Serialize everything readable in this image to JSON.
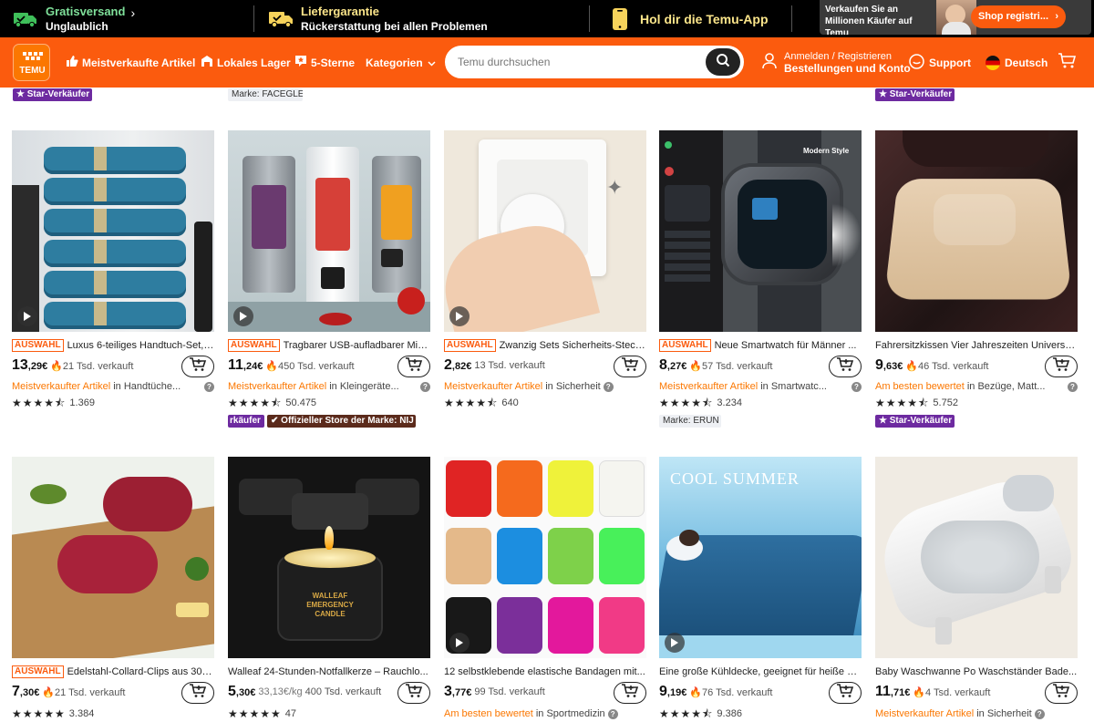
{
  "promo": {
    "shipping_title": "Gratisversand",
    "shipping_sub": "Unglaublich",
    "guarantee_title": "Liefergarantie",
    "guarantee_sub": "Rückerstattung bei allen Problemen",
    "app": "Hol dir die Temu-App",
    "sell_text": "Verkaufen Sie an Millionen Käufer auf Temu",
    "shop_btn": "Shop registri..."
  },
  "nav": {
    "logo": "TEMU",
    "best": "Meistverkaufte Artikel",
    "local": "Lokales Lager",
    "stars": "5-Sterne",
    "cat": "Kategorien",
    "search_placeholder": "Temu durchsuchen",
    "login": "Anmelden / Registrieren",
    "orders": "Bestellungen und Konto",
    "support": "Support",
    "lang": "Deutsch"
  },
  "badges": {
    "star": "Star-Verkäufer",
    "brand_top": "Marke: FACEGLE",
    "star_right": "Star-Verkäufer",
    "row2_left": "rkäufer",
    "official": "Offizieller Store der Marke: NIJ",
    "brand_erun": "Marke: ERUN",
    "star_row2": "Star-Verkäufer"
  },
  "products": [
    {
      "tag": "AUSWAHL",
      "title": "Luxus 6-teiliges Handtuch-Set, ...",
      "price_int": "13",
      "price_dec": ",29€",
      "sold": "21 Tsd. verkauft",
      "hl": "Meistverkaufter Artikel",
      "cat": "in Handtüche...",
      "stars": "★★★★⯪",
      "rating": "1.369"
    },
    {
      "tag": "AUSWAHL",
      "title": "Tragbarer USB-aufladbarer Mix...",
      "price_int": "11",
      "price_dec": ",24€",
      "sold": "450 Tsd. verkauft",
      "hl": "Meistverkaufter Artikel",
      "cat": "in Kleingeräte...",
      "stars": "★★★★⯪",
      "rating": "50.475"
    },
    {
      "tag": "AUSWAHL",
      "title": "Zwanzig Sets Sicherheits-Steck...",
      "price_int": "2",
      "price_dec": ",82€",
      "sold": "13 Tsd. verkauft",
      "hl": "Meistverkaufter Artikel",
      "cat": "in Sicherheit",
      "stars": "★★★★⯪",
      "rating": "640"
    },
    {
      "tag": "AUSWAHL",
      "title": "Neue Smartwatch für Männer ...",
      "price_int": "8",
      "price_dec": ",27€",
      "sold": "57 Tsd. verkauft",
      "hl": "Meistverkaufter Artikel",
      "cat": "in Smartwatc...",
      "stars": "★★★★⯪",
      "rating": "3.234"
    },
    {
      "tag": "",
      "title": "Fahrersitzkissen Vier Jahreszeiten Universal...",
      "price_int": "9",
      "price_dec": ",63€",
      "sold": "46 Tsd. verkauft",
      "hl": "Am besten bewertet",
      "cat": "in Bezüge, Matt...",
      "stars": "★★★★⯪",
      "rating": "5.752"
    },
    {
      "tag": "AUSWAHL",
      "title": "Edelstahl-Collard-Clips aus 304...",
      "price_int": "7",
      "price_dec": ",30€",
      "sold": "21 Tsd. verkauft",
      "hl": "",
      "cat": "",
      "stars": "★★★★★",
      "rating": "3.384"
    },
    {
      "tag": "",
      "title": "Walleaf 24-Stunden-Notfallkerze – Rauchlo...",
      "price_int": "5",
      "price_dec": ",30€",
      "sold": "400 Tsd. verkauft",
      "unit": "33,13€/kg",
      "hl": "",
      "cat": "",
      "stars": "★★★★★",
      "rating": "47"
    },
    {
      "tag": "",
      "title": "12 selbstklebende elastische Bandagen mit...",
      "price_int": "3",
      "price_dec": ",77€",
      "sold": "99 Tsd. verkauft",
      "hl": "Am besten bewertet",
      "cat": "in Sportmedizin",
      "stars": "",
      "rating": ""
    },
    {
      "tag": "",
      "title": "Eine große Kühldecke, geeignet für heiße S...",
      "price_int": "9",
      "price_dec": ",19€",
      "sold": "76 Tsd. verkauft",
      "hl": "",
      "cat": "",
      "stars": "★★★★⯪",
      "rating": "9.386"
    },
    {
      "tag": "",
      "title": "Baby Waschwanne Po Waschständer Bade...",
      "price_int": "11",
      "price_dec": ",71€",
      "sold": "4 Tsd. verkauft",
      "hl": "Meistverkaufter Artikel",
      "cat": "in Sicherheit",
      "stars": "",
      "rating": ""
    }
  ],
  "image_texts": {
    "watch_label": "Modern Style",
    "candle_brand": "WALLEAF",
    "candle_line1": "EMERGENCY",
    "candle_line2": "CANDLE",
    "cool_summer": "COOL SUMMER"
  },
  "colors": {
    "brand": "#fb5b0e",
    "highlight": "#fb7701",
    "star_badge": "#6d2aa0"
  }
}
